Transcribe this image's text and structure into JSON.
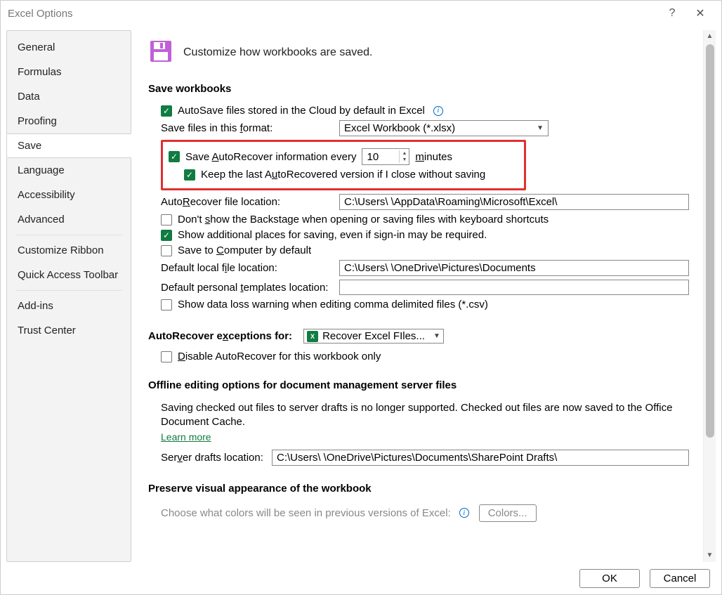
{
  "window": {
    "title": "Excel Options"
  },
  "sidebar": {
    "items": [
      "General",
      "Formulas",
      "Data",
      "Proofing",
      "Save",
      "Language",
      "Accessibility",
      "Advanced"
    ],
    "items2": [
      "Customize Ribbon",
      "Quick Access Toolbar"
    ],
    "items3": [
      "Add-ins",
      "Trust Center"
    ],
    "selected": "Save"
  },
  "header": {
    "desc": "Customize how workbooks are saved."
  },
  "save": {
    "section": "Save workbooks",
    "autosave": {
      "checked": true,
      "label_pre": "AutoSave files stored in the Cloud by default in Excel"
    },
    "format": {
      "label": "Save files in this format:",
      "value": "Excel Workbook (*.xlsx)"
    },
    "autorecover": {
      "checked": true,
      "label": "Save AutoRecover information every",
      "minutes": "10",
      "unit": "minutes"
    },
    "keeplast": {
      "checked": true,
      "label": "Keep the last AutoRecovered version if I close without saving"
    },
    "ar_loc": {
      "label": "AutoRecover file location:",
      "value": "C:\\Users\\          \\AppData\\Roaming\\Microsoft\\Excel\\"
    },
    "backstage": {
      "checked": false,
      "label": "Don't show the Backstage when opening or saving files with keyboard shortcuts"
    },
    "addplaces": {
      "checked": true,
      "label": "Show additional places for saving, even if sign-in may be required."
    },
    "savecomp": {
      "checked": false,
      "label": "Save to Computer by default"
    },
    "def_local": {
      "label": "Default local file location:",
      "value": "C:\\Users\\        \\OneDrive\\Pictures\\Documents"
    },
    "def_tmpl": {
      "label": "Default personal templates location:",
      "value": ""
    },
    "csvwarn": {
      "checked": false,
      "label": "Show data loss warning when editing comma delimited files (*.csv)"
    }
  },
  "arex": {
    "section": "AutoRecover exceptions for:",
    "workbook": "Recover Excel FIles...",
    "disable": {
      "checked": false,
      "label": "Disable AutoRecover for this workbook only"
    }
  },
  "offline": {
    "section": "Offline editing options for document management server files",
    "note": "Saving checked out files to server drafts is no longer supported. Checked out files are now saved to the Office Document Cache.",
    "learn": "Learn more",
    "drafts": {
      "label": "Server drafts location:",
      "value": "C:\\Users\\        \\OneDrive\\Pictures\\Documents\\SharePoint Drafts\\"
    }
  },
  "preserve": {
    "section": "Preserve visual appearance of the workbook",
    "note": "Choose what colors will be seen in previous versions of Excel:",
    "btn": "Colors..."
  },
  "footer": {
    "ok": "OK",
    "cancel": "Cancel"
  }
}
